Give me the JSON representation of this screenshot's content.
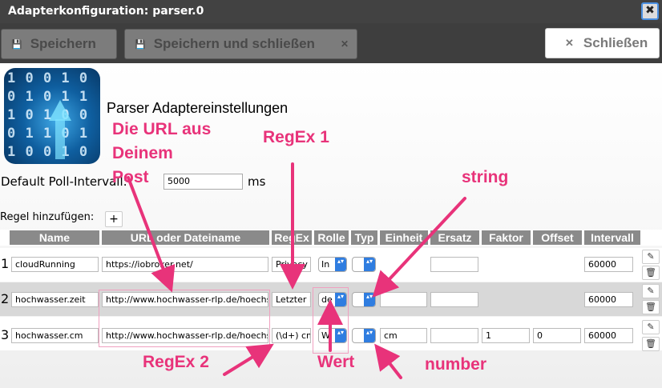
{
  "window": {
    "title": "Adapterkonfiguration: parser.0",
    "close_glyph": "✖"
  },
  "toolbar": {
    "save_label": "Speichern",
    "save_close_label": "Speichern und schließen",
    "close_label": "Schließen",
    "save_icon": "💾",
    "close_icon": "✕"
  },
  "header": {
    "title": "Parser Adaptereinstellungen"
  },
  "settings": {
    "poll_label": "Default Poll-Intervall:",
    "poll_value": "5000",
    "poll_unit": "ms"
  },
  "rules": {
    "add_label": "Regel hinzufügen:",
    "add_symbol": "+",
    "columns": [
      "Name",
      "URL oder Dateiname",
      "RegEx",
      "Rolle",
      "Typ",
      "Einheit",
      "Ersatz",
      "Faktor",
      "Offset",
      "Intervall"
    ],
    "rows": [
      {
        "num": "1",
        "name": "cloudRunning",
        "url": "https://iobroker.net/",
        "regex": "Privacy N",
        "role": "In",
        "type": "",
        "unit": "",
        "subst": "",
        "factor": "",
        "offset": "",
        "interval": "60000"
      },
      {
        "num": "2",
        "name": "hochwasser.zeit",
        "url": "http://www.hochwasser-rlp.de/hoechst",
        "regex": "Letzter M",
        "role": "de",
        "type": "",
        "unit": "",
        "subst": "",
        "factor": "",
        "offset": "",
        "interval": "60000"
      },
      {
        "num": "3",
        "name": "hochwasser.cm",
        "url": "http://www.hochwasser-rlp.de/hoechst",
        "regex": "(\\d+) cm",
        "role": "W",
        "type": "",
        "unit": "cm",
        "subst": "",
        "factor": "1",
        "offset": "0",
        "interval": "60000"
      }
    ]
  },
  "annotations": {
    "url": [
      "Die URL aus",
      "Deinem",
      "Post"
    ],
    "regex1": "RegEx 1",
    "string": "string",
    "regex2": "RegEx 2",
    "wert": "Wert",
    "number": "number"
  },
  "colors": {
    "annotation": "#e8337a",
    "select_accent": "#2f7de0",
    "titlebar": "#424242",
    "header_cell": "#8a8a8a"
  },
  "logo": {
    "digits": "1 0 0 1 0\n0 1 0 1 1\n1 0 1 0 0\n0 1 1 0 1\n1 0 0 1 0"
  },
  "icons": {
    "edit": "✎",
    "delete": "🗑",
    "chevrons": "▴▾"
  }
}
